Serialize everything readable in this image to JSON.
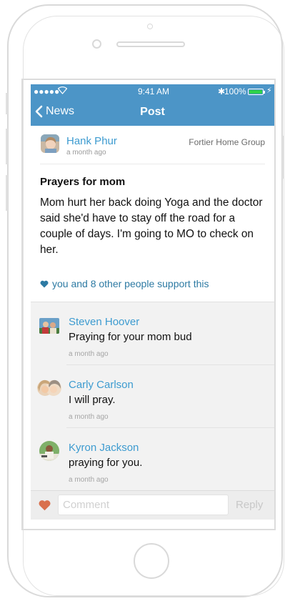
{
  "status_bar": {
    "signal": "●●●●● ",
    "wifi": "wifi-icon",
    "time": "9:41 AM",
    "bluetooth": "✱",
    "battery_text": "100%",
    "charging": "⚡"
  },
  "nav": {
    "back_label": "News",
    "title": "Post"
  },
  "post": {
    "author": "Hank Phur",
    "time_ago": "a month ago",
    "group": "Fortier Home Group",
    "title": "Prayers for mom",
    "body": "Mom hurt her back doing Yoga and the doctor said she'd have to stay off the road for a couple of days. I'm going to MO to check on her.",
    "support_text": "you and 8 other people support this"
  },
  "comments": [
    {
      "name": "Steven Hoover",
      "text": "Praying for your mom bud",
      "time_ago": "a month ago"
    },
    {
      "name": "Carly Carlson",
      "text": "I will pray.",
      "time_ago": "a month ago"
    },
    {
      "name": "Kyron Jackson",
      "text": "praying for you.",
      "time_ago": "a month ago"
    }
  ],
  "composer": {
    "placeholder": "Comment",
    "reply_label": "Reply"
  },
  "colors": {
    "nav_bar": "#4c95c7",
    "name_link": "#3d9bd0",
    "support_link": "#2d7aa3",
    "heart": "#d9704d"
  }
}
